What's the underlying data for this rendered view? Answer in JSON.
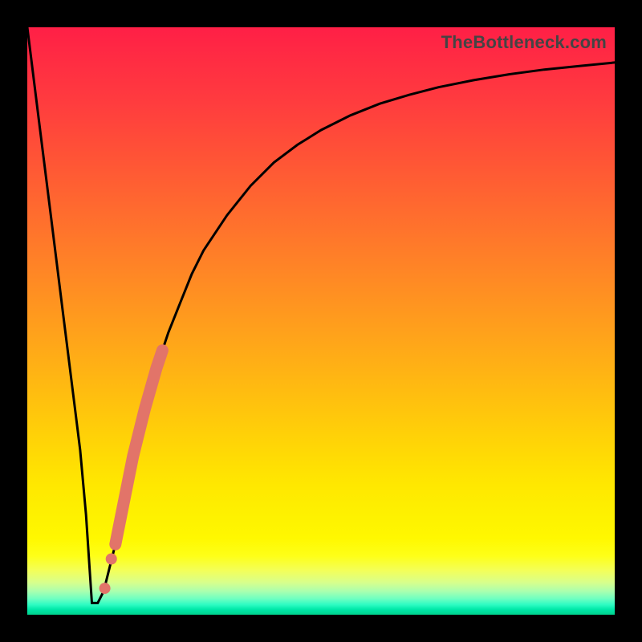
{
  "watermark": "TheBottleneck.com",
  "colors": {
    "frame": "#000000",
    "curve": "#000000",
    "marker": "#e27469",
    "gradient_stops": [
      "#ff1f46",
      "#ff3a3f",
      "#ff6d2e",
      "#ffa41a",
      "#ffd805",
      "#fff800",
      "#d8ff8c",
      "#2dfcc3",
      "#00d28e"
    ]
  },
  "chart_data": {
    "type": "line",
    "title": "",
    "xlabel": "",
    "ylabel": "",
    "x_range": [
      0,
      100
    ],
    "y_range": [
      0,
      100
    ],
    "note": "y-axis inverted visually (0 at bottom, 100 at top); curve shows bottleneck % vs component index; minimum near x≈11",
    "series": [
      {
        "name": "bottleneck-curve",
        "x": [
          0,
          2,
          4,
          6,
          8,
          9,
          10,
          11,
          12,
          13,
          14,
          15,
          16,
          17,
          18,
          19,
          20,
          22,
          24,
          26,
          28,
          30,
          34,
          38,
          42,
          46,
          50,
          55,
          60,
          65,
          70,
          76,
          82,
          88,
          94,
          100
        ],
        "y": [
          100,
          84,
          68,
          52,
          36,
          28,
          17,
          2,
          2,
          4,
          8,
          12,
          17,
          22,
          27,
          31,
          35,
          42,
          48,
          53,
          58,
          62,
          68,
          73,
          77,
          80,
          82.5,
          85,
          87,
          88.5,
          89.8,
          91,
          92,
          92.8,
          93.4,
          94
        ]
      }
    ],
    "markers": {
      "name": "highlight-segment",
      "comment": "salmon-colored thick stroke along curve on rising branch",
      "points": [
        {
          "x": 13.2,
          "y": 4.5
        },
        {
          "x": 14.3,
          "y": 9.5
        },
        {
          "x": 15.0,
          "y": 12.0
        },
        {
          "x": 16.0,
          "y": 17.0
        },
        {
          "x": 18.0,
          "y": 27.0
        },
        {
          "x": 20.0,
          "y": 35.0
        },
        {
          "x": 22.0,
          "y": 42.0
        },
        {
          "x": 23.0,
          "y": 45.0
        }
      ]
    }
  }
}
